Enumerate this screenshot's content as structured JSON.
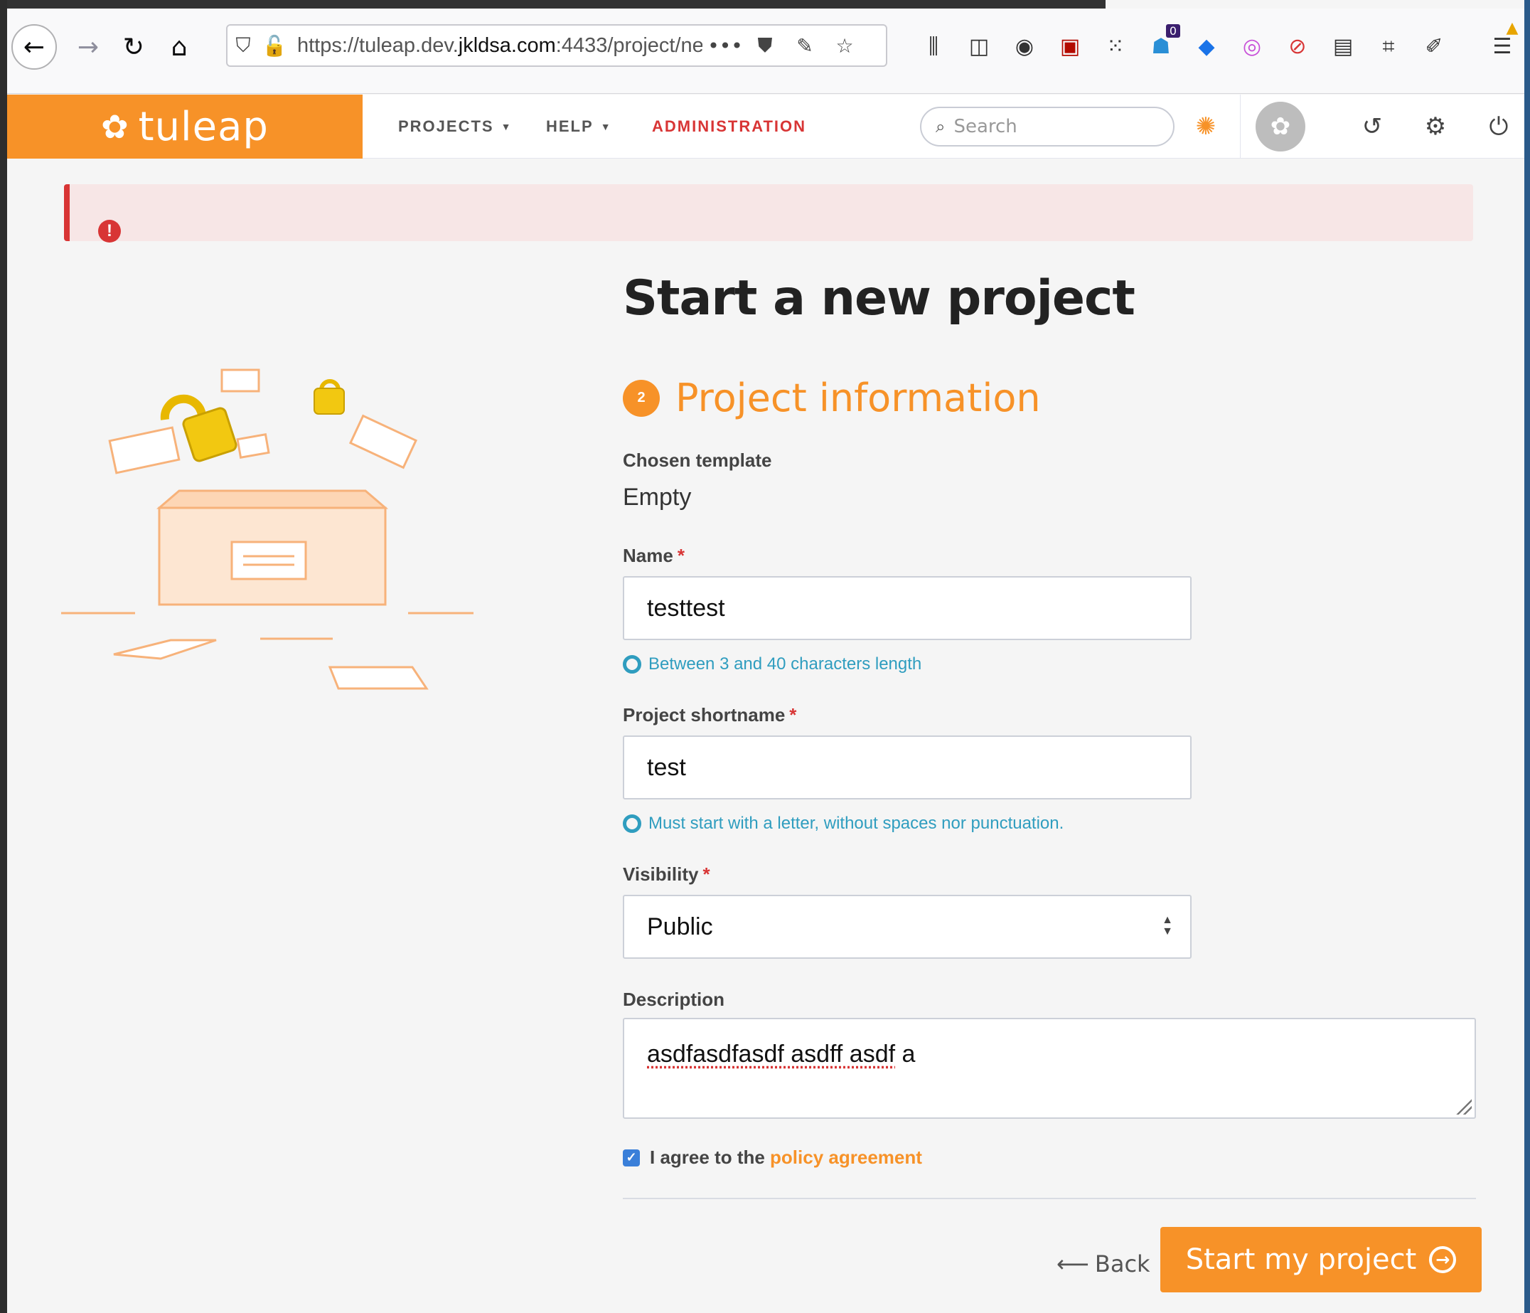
{
  "browser": {
    "url_prefix": "https://tuleap.dev.",
    "url_host": "jkldsa.com",
    "url_suffix": ":4433/project/ne",
    "more_label": "•••",
    "extension_badge": "0"
  },
  "header": {
    "logo_text": "tuleap",
    "menu": {
      "projects": "PROJECTS",
      "help": "HELP",
      "administration": "ADMINISTRATION"
    },
    "search_placeholder": "Search"
  },
  "alert": {
    "icon": "!"
  },
  "page": {
    "title": "Start a new project",
    "step_number": "2",
    "step_title": "Project information"
  },
  "form": {
    "template_label": "Chosen template",
    "template_value": "Empty",
    "name_label": "Name",
    "required_mark": "*",
    "name_value": "testtest",
    "name_hint": "Between 3 and 40 characters length",
    "shortname_label": "Project shortname",
    "shortname_value": "test",
    "shortname_hint": "Must start with a letter, without spaces nor punctuation.",
    "visibility_label": "Visibility",
    "visibility_value": "Public",
    "description_label": "Description",
    "description_misspelled": "asdfasdfasdf asdff asdf",
    "description_rest": " a",
    "agree_text": "I agree to the ",
    "agree_link": "policy agreement",
    "agree_checked": true,
    "back_label": "Back",
    "submit_label": "Start my project"
  },
  "colors": {
    "brand": "#f79228",
    "danger": "#d83535",
    "info": "#2f9dbf",
    "checkbox": "#3a7fd9"
  }
}
